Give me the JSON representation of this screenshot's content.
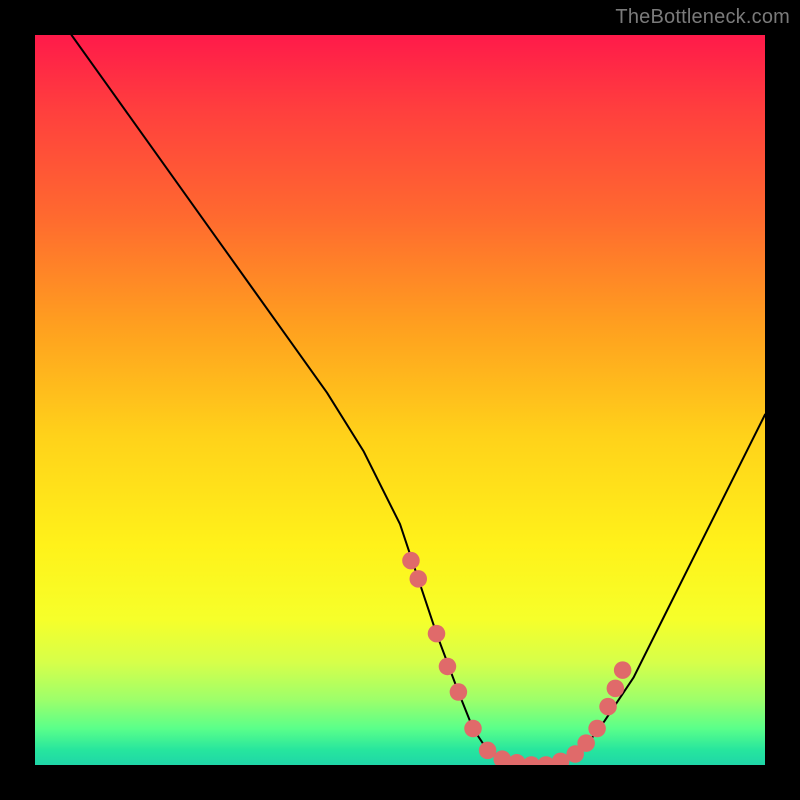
{
  "watermark": "TheBottleneck.com",
  "chart_data": {
    "type": "line",
    "title": "",
    "xlabel": "",
    "ylabel": "",
    "xlim": [
      0,
      100
    ],
    "ylim": [
      0,
      100
    ],
    "background_gradient": {
      "top_color": "#ff1a4a",
      "bottom_color": "#1fd6a8",
      "meaning": "red = high bottleneck, green = low bottleneck"
    },
    "series": [
      {
        "name": "bottleneck-curve",
        "stroke": "#000000",
        "x": [
          5,
          10,
          15,
          20,
          25,
          30,
          35,
          40,
          45,
          50,
          52,
          55,
          58,
          60,
          62,
          65,
          68,
          70,
          72,
          75,
          78,
          82,
          86,
          90,
          94,
          98,
          100
        ],
        "y": [
          100,
          93,
          86,
          79,
          72,
          65,
          58,
          51,
          43,
          33,
          27,
          18,
          10,
          5,
          2,
          0.5,
          0,
          0,
          0.5,
          2,
          6,
          12,
          20,
          28,
          36,
          44,
          48
        ]
      }
    ],
    "markers": {
      "name": "highlighted-range-dots",
      "fill": "#e06a6a",
      "radius": 1.2,
      "x": [
        51.5,
        52.5,
        55.0,
        56.5,
        58.0,
        60.0,
        62.0,
        64.0,
        66.0,
        68.0,
        70.0,
        72.0,
        74.0,
        75.5,
        77.0,
        78.5,
        79.5,
        80.5
      ],
      "y": [
        28.0,
        25.5,
        18.0,
        13.5,
        10.0,
        5.0,
        2.0,
        0.8,
        0.3,
        0.0,
        0.0,
        0.5,
        1.5,
        3.0,
        5.0,
        8.0,
        10.5,
        13.0
      ]
    }
  }
}
